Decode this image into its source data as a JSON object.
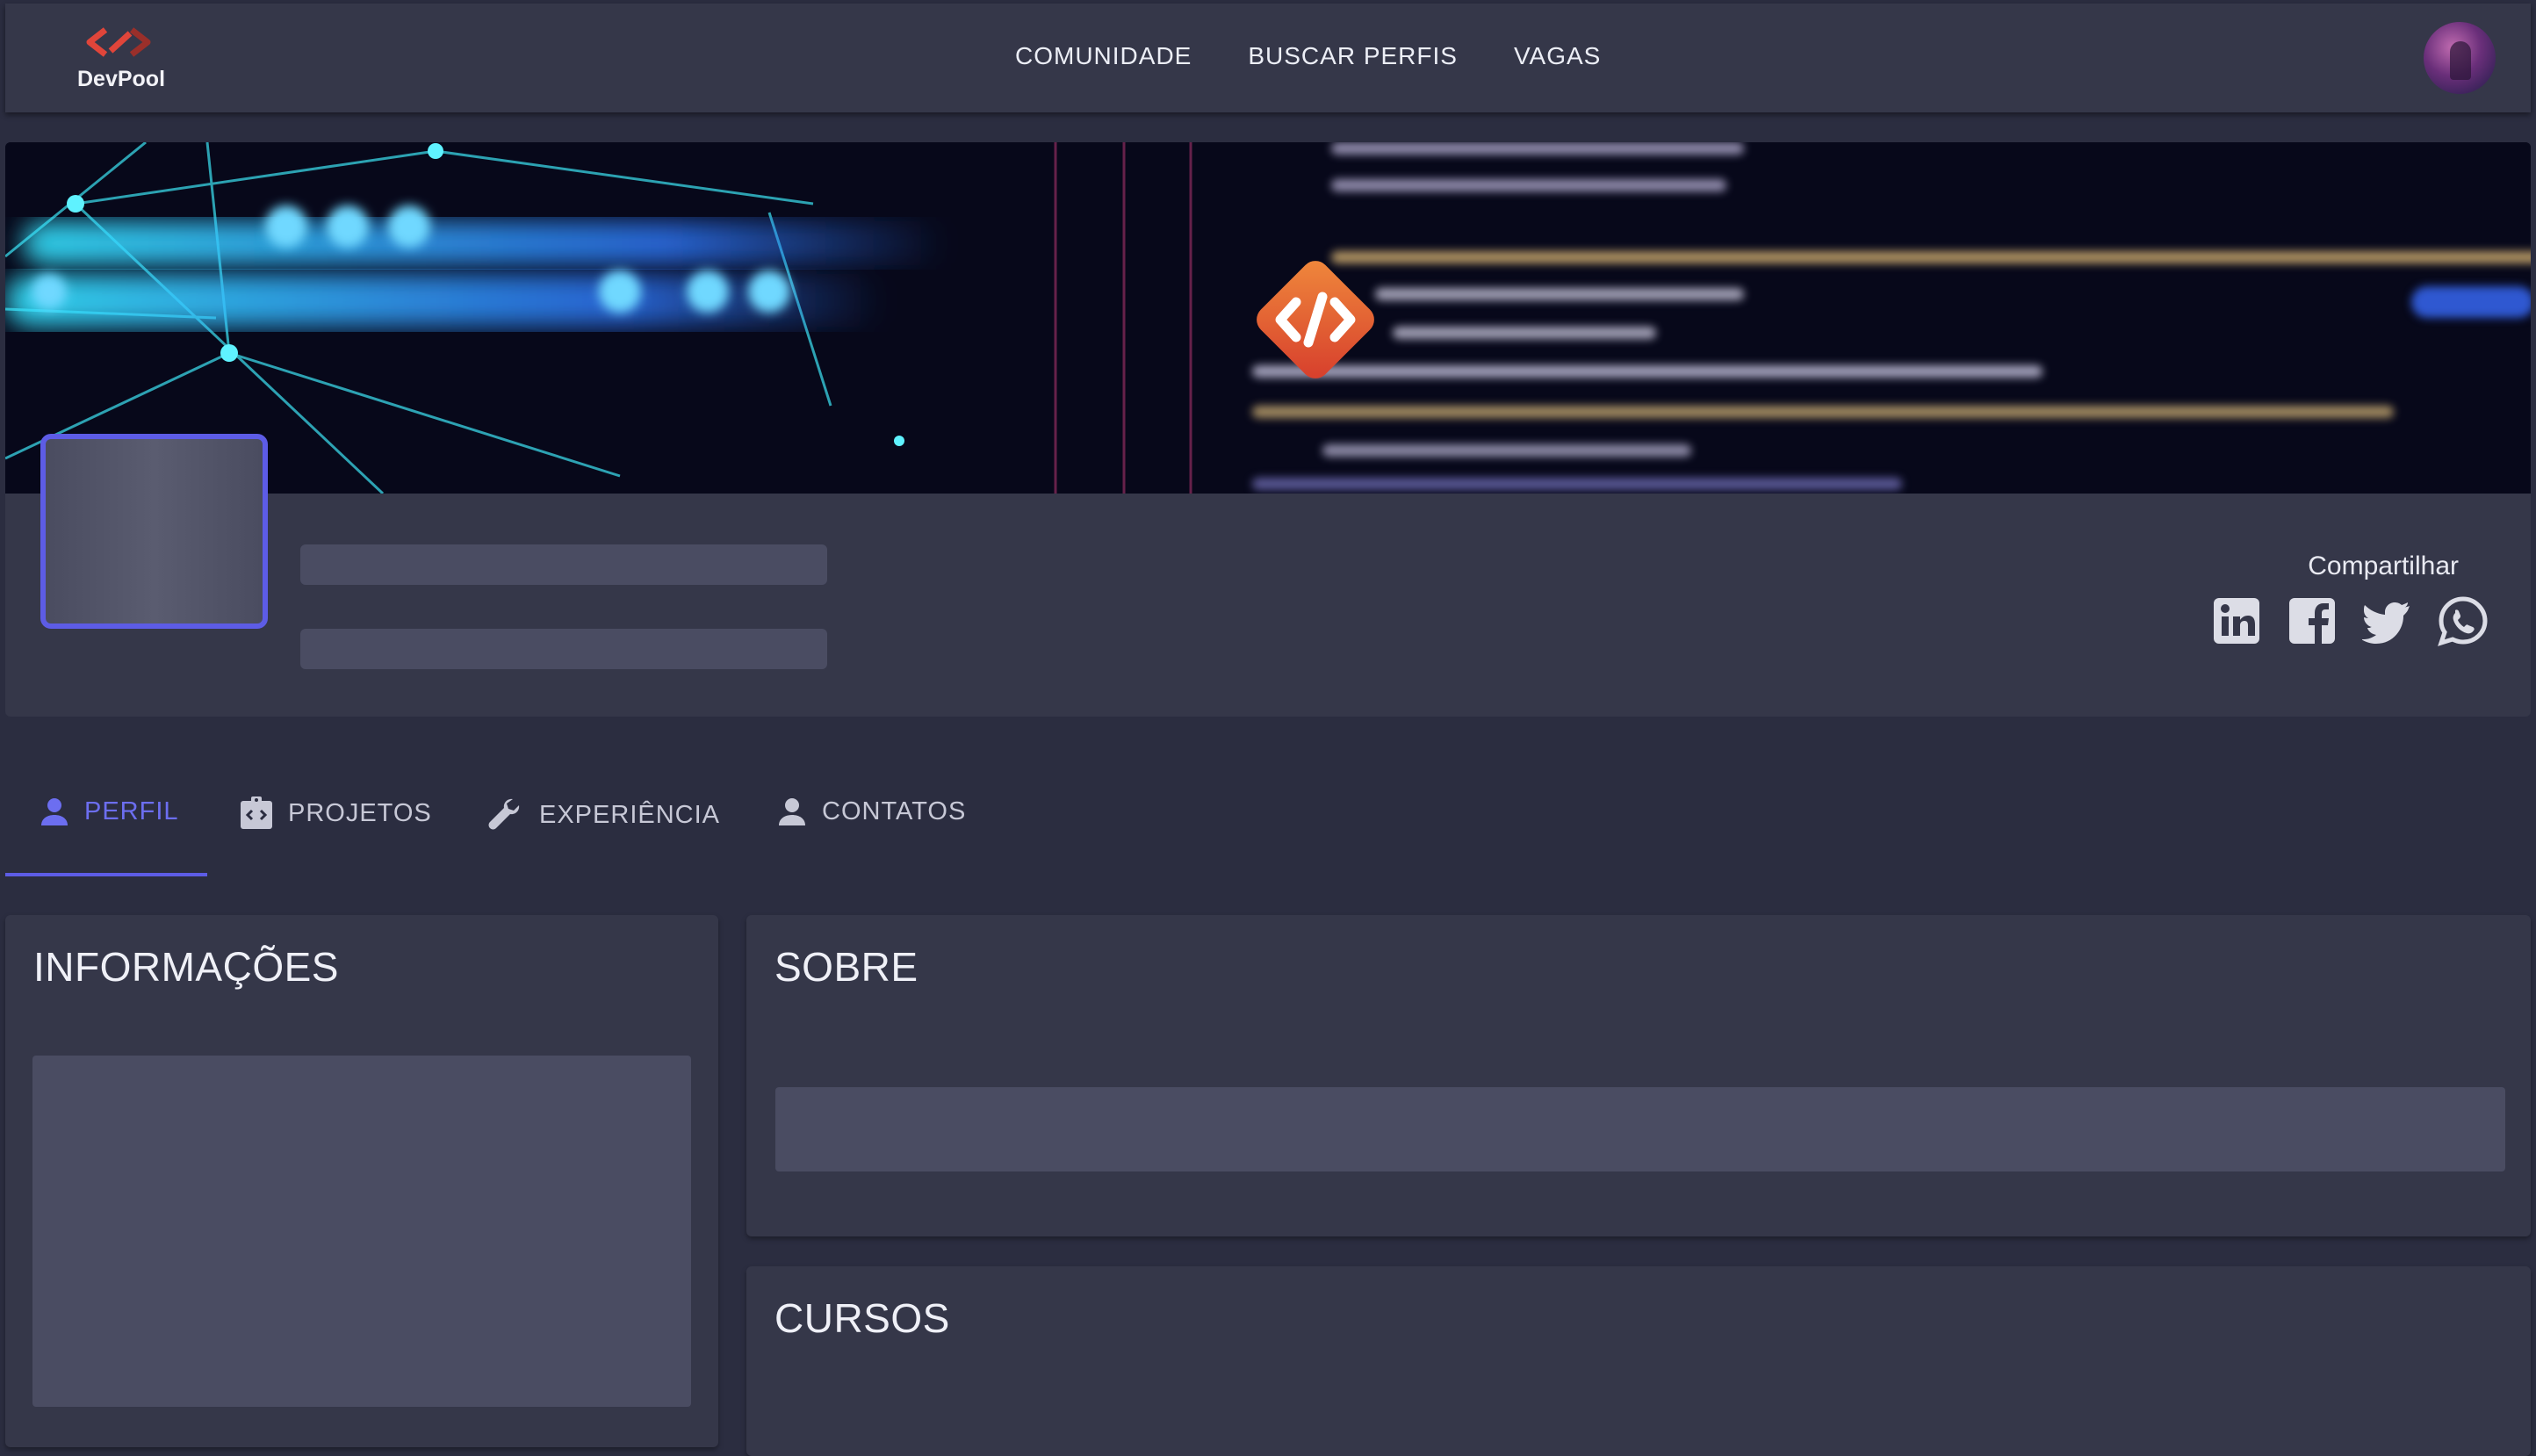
{
  "app": {
    "name": "DevPool"
  },
  "nav": {
    "links": [
      "COMUNIDADE",
      "BUSCAR PERFIS",
      "VAGAS"
    ]
  },
  "icons": {
    "logo": "devpool-logo-icon",
    "avatar": "user-avatar",
    "banner_badge": "code-diamond-icon",
    "share": [
      "linkedin-icon",
      "facebook-icon",
      "twitter-icon",
      "whatsapp-icon"
    ],
    "tabs": [
      "person-icon",
      "project-badge-icon",
      "wrench-icon",
      "person-icon"
    ]
  },
  "profile": {
    "share_label": "Compartilhar"
  },
  "tabs": [
    {
      "label": "PERFIL",
      "active": true
    },
    {
      "label": "PROJETOS",
      "active": false
    },
    {
      "label": "EXPERIÊNCIA",
      "active": false
    },
    {
      "label": "CONTATOS",
      "active": false
    }
  ],
  "sections": {
    "info_title": "INFORMAÇÕES",
    "about_title": "SOBRE",
    "courses_title": "CURSOS"
  },
  "colors": {
    "background": "#2b2d40",
    "surface": "#353749",
    "accent": "#5d5ce6",
    "skeleton": "#4a4c62",
    "brand_orange": "#e8643a"
  }
}
